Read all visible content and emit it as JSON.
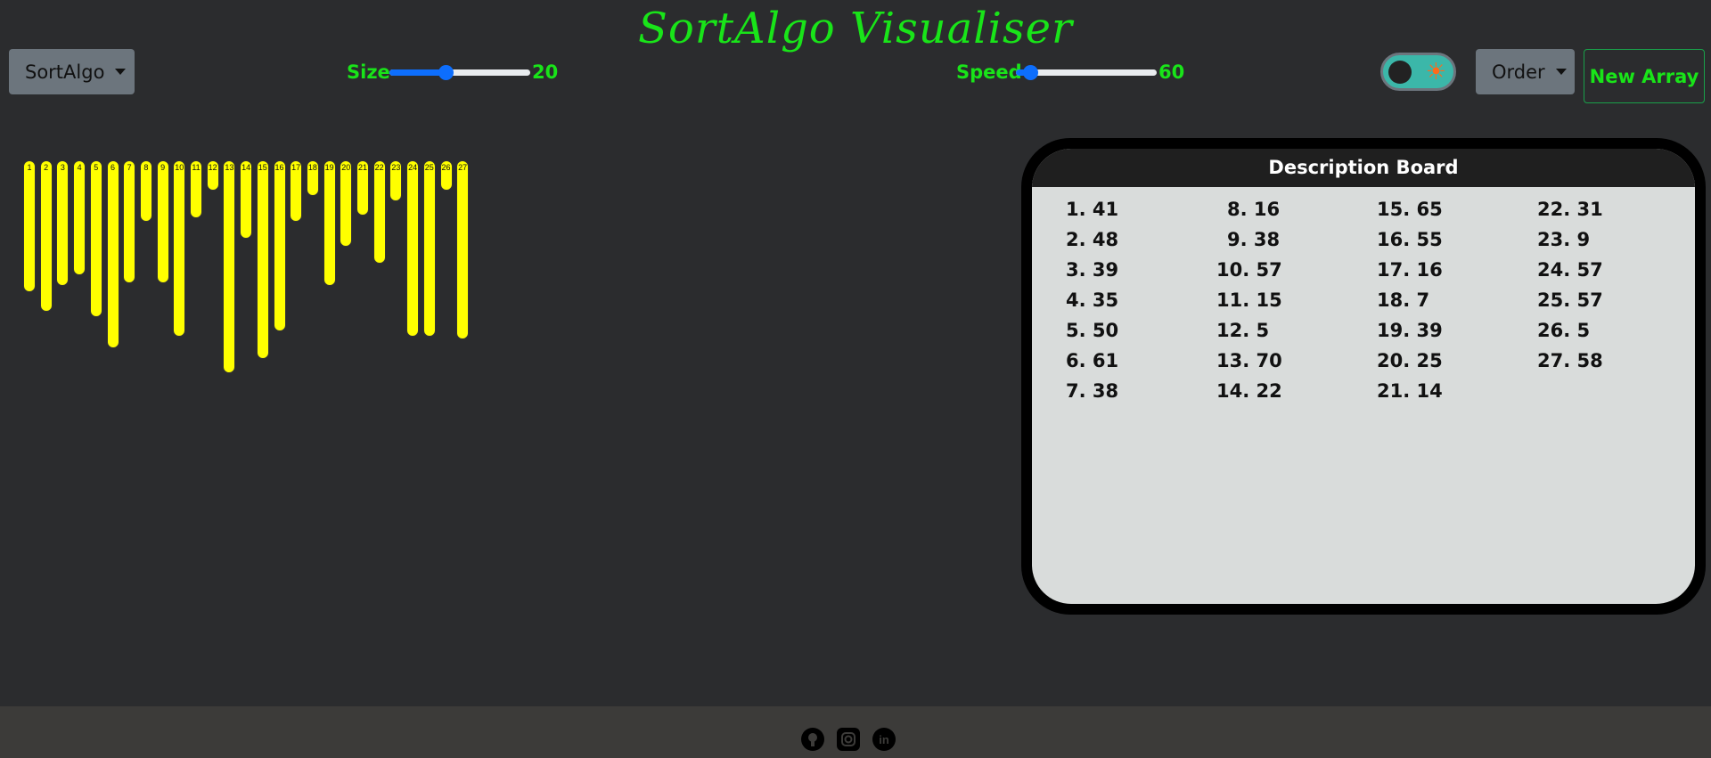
{
  "app": {
    "title": "SortAlgo Visualiser"
  },
  "toolbar": {
    "algo_label": "SortAlgo",
    "size_label": "Size",
    "size_value": "20",
    "size_fraction": 0.4,
    "speed_label": "Speed",
    "speed_value": "60",
    "speed_fraction": 0.1,
    "order_label": "Order",
    "new_array_label": "New Array",
    "theme_toggle_icon": "sun-icon"
  },
  "bars": [
    {
      "index": "1",
      "value": 41
    },
    {
      "index": "2",
      "value": 48
    },
    {
      "index": "3",
      "value": 39
    },
    {
      "index": "4",
      "value": 35
    },
    {
      "index": "5",
      "value": 50
    },
    {
      "index": "6",
      "value": 61
    },
    {
      "index": "7",
      "value": 38
    },
    {
      "index": "8",
      "value": 16
    },
    {
      "index": "9",
      "value": 38
    },
    {
      "index": "10",
      "value": 57
    },
    {
      "index": "11",
      "value": 15
    },
    {
      "index": "12",
      "value": 5
    },
    {
      "index": "13",
      "value": 70
    },
    {
      "index": "14",
      "value": 22
    },
    {
      "index": "15",
      "value": 65
    },
    {
      "index": "16",
      "value": 55
    },
    {
      "index": "17",
      "value": 16
    },
    {
      "index": "18",
      "value": 7
    },
    {
      "index": "19",
      "value": 39
    },
    {
      "index": "20",
      "value": 25
    },
    {
      "index": "21",
      "value": 14
    },
    {
      "index": "22",
      "value": 31
    },
    {
      "index": "23",
      "value": 9
    },
    {
      "index": "24",
      "value": 57
    },
    {
      "index": "25",
      "value": 57
    },
    {
      "index": "26",
      "value": 5
    },
    {
      "index": "27",
      "value": 58
    }
  ],
  "board": {
    "title": "Description Board",
    "columns": [
      [
        "1. 41",
        "2. 48",
        "3. 39",
        "4. 35",
        "5. 50",
        "6. 61",
        "7. 38"
      ],
      [
        "8. 16",
        "9. 38",
        "10. 57",
        "11. 15",
        "12. 5",
        "13. 70",
        "14. 22"
      ],
      [
        "15. 65",
        "16. 55",
        "17. 16",
        "18. 7",
        "19. 39",
        "20. 25",
        "21. 14"
      ],
      [
        "22. 31",
        "23. 9",
        "24. 57",
        "25. 57",
        "26. 5",
        "27. 58"
      ]
    ]
  },
  "footer": {
    "icons": [
      "github-icon",
      "instagram-icon",
      "linkedin-icon"
    ]
  },
  "colors": {
    "accent": "#19e419",
    "bar": "#ffff00",
    "background": "#2b2c2e"
  }
}
